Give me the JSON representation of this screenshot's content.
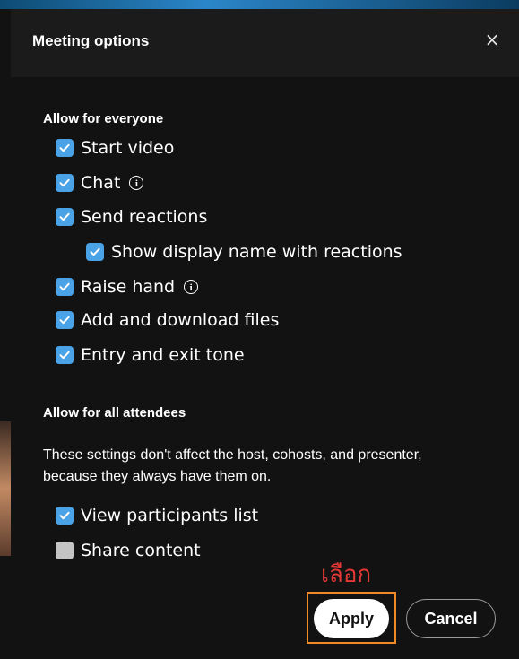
{
  "dialog": {
    "title": "Meeting options",
    "close_glyph": "×"
  },
  "sections": {
    "everyone": {
      "title": "Allow for everyone",
      "options": [
        {
          "label": "Start video",
          "checked": true,
          "info": false
        },
        {
          "label": "Chat",
          "checked": true,
          "info": true
        },
        {
          "label": "Send reactions",
          "checked": true,
          "info": false
        },
        {
          "label": "Show display name with reactions",
          "checked": true,
          "info": false,
          "indent": true
        },
        {
          "label": "Raise hand",
          "checked": true,
          "info": true
        },
        {
          "label": "Add and download files",
          "checked": true,
          "info": false
        },
        {
          "label": "Entry and exit tone",
          "checked": true,
          "info": false
        }
      ]
    },
    "attendees": {
      "title": "Allow for all attendees",
      "description": "These settings don't affect the host, cohosts, and presenter, because they always have them on.",
      "options": [
        {
          "label": "View participants list",
          "checked": true
        },
        {
          "label": "Share content",
          "checked": false
        }
      ]
    }
  },
  "annotation": {
    "text": "เลือก",
    "color": "#e53935"
  },
  "buttons": {
    "apply": "Apply",
    "cancel": "Cancel"
  },
  "colors": {
    "checkbox_on": "#4aa3e6",
    "checkbox_off": "#c4c4c4",
    "highlight_box": "#f08a24"
  },
  "icons": {
    "close": "close-icon",
    "info": "info-icon",
    "check": "checkmark-icon"
  }
}
